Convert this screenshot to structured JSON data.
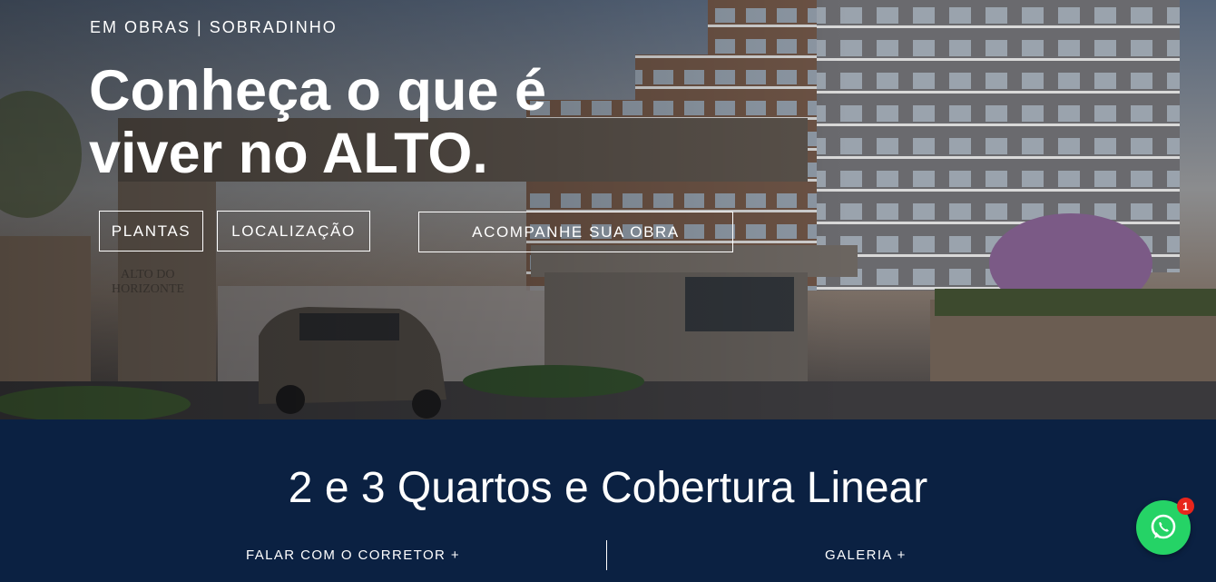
{
  "hero": {
    "eyebrow": "EM OBRAS | SOBRADINHO",
    "headline_line1": "Conheça o que é",
    "headline_line2": "viver no ALTO.",
    "buttons": {
      "plantas": "PLANTAS",
      "localizacao": "LOCALIZAÇÃO",
      "acompanhe": "ACOMPANHE SUA OBRA"
    }
  },
  "band": {
    "title": "2 e 3 Quartos e Cobertura Linear",
    "links": {
      "corretor": "FALAR COM O CORRETOR +",
      "galeria": "GALERIA +"
    }
  },
  "whatsapp": {
    "badge_count": "1",
    "icon": "whatsapp-icon"
  },
  "colors": {
    "band_bg": "#0b2142",
    "whatsapp_green": "#25d366",
    "badge_red": "#e8251c"
  }
}
